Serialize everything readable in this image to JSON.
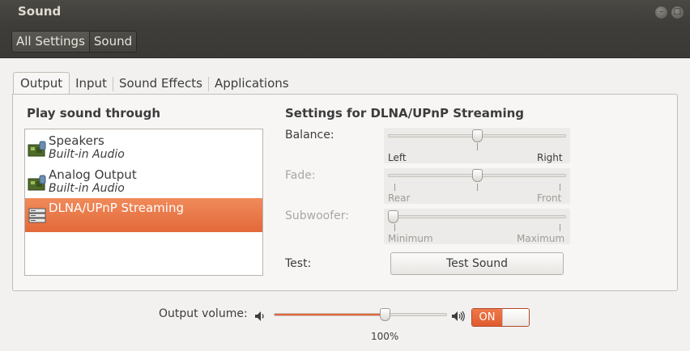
{
  "window": {
    "title": "Sound"
  },
  "breadcrumb": [
    "All Settings",
    "Sound"
  ],
  "tabs": [
    {
      "label": "Output",
      "active": true
    },
    {
      "label": "Input",
      "active": false
    },
    {
      "label": "Sound Effects",
      "active": false
    },
    {
      "label": "Applications",
      "active": false
    }
  ],
  "output": {
    "play_heading": "Play sound through",
    "devices": [
      {
        "name": "Speakers",
        "sub": "Built-in Audio",
        "icon": "sound-card-icon",
        "selected": false
      },
      {
        "name": "Analog Output",
        "sub": "Built-in Audio",
        "icon": "sound-card-icon",
        "selected": false
      },
      {
        "name": "DLNA/UPnP Streaming",
        "sub": "",
        "icon": "network-server-icon",
        "selected": true
      }
    ],
    "settings_heading": "Settings for DLNA/UPnP Streaming",
    "balance": {
      "label": "Balance:",
      "left": "Left",
      "right": "Right",
      "value": 0.5,
      "enabled": true
    },
    "fade": {
      "label": "Fade:",
      "left": "Rear",
      "right": "Front",
      "value": 0.5,
      "enabled": false
    },
    "subwoofer": {
      "label": "Subwoofer:",
      "left": "Minimum",
      "right": "Maximum",
      "value": 0.0,
      "enabled": false
    },
    "test_label": "Test:",
    "test_button": "Test Sound"
  },
  "volume": {
    "label": "Output volume:",
    "percent_text": "100%",
    "level": 0.64,
    "toggle_on_label": "ON"
  },
  "colors": {
    "accent": "#e5643a",
    "titlebar": "#3e3d39"
  }
}
